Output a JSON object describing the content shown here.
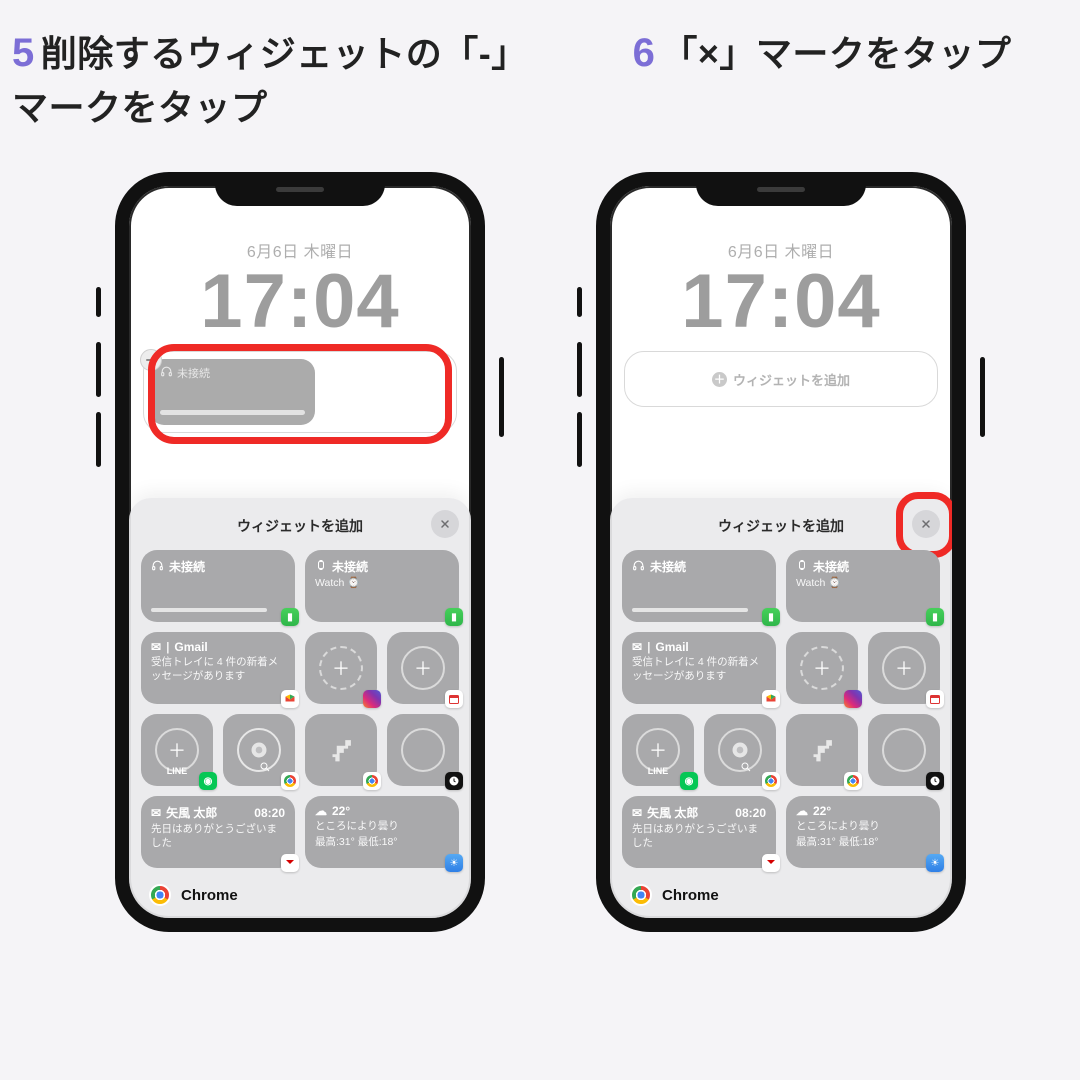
{
  "captions": {
    "step5": {
      "num": "5",
      "text": "削除するウィジェットの「-」マークをタップ"
    },
    "step6": {
      "num": "6",
      "text": "「×」マークをタップ"
    }
  },
  "lockscreen": {
    "date": "6月6日 木曜日",
    "time": "17:04",
    "widget_unconnected": "未接続",
    "add_widget_label": "ウィジェットを追加"
  },
  "sheet": {
    "title": "ウィジェットを追加"
  },
  "widgets": {
    "airpods": {
      "title": "未接続"
    },
    "watch": {
      "title": "未接続",
      "sub": "Watch"
    },
    "gmail": {
      "title": "Gmail",
      "sub": "受信トレイに 4 件の新着メッセージがあります"
    },
    "line": {
      "label": "LINE"
    },
    "mail": {
      "from": "矢風 太郎",
      "time": "08:20",
      "body": "先日はありがとうございました"
    },
    "weather": {
      "temp": "22°",
      "desc": "ところにより曇り",
      "range": "最高:31° 最低:18°"
    }
  },
  "suggestion": {
    "app": "Chrome"
  },
  "icons": {
    "minus": "minus-icon",
    "close": "close-icon",
    "plus": "plus-icon",
    "headphones": "headphones-icon",
    "watch": "watch-icon",
    "gmail": "gmail-icon",
    "chrome": "chrome-icon",
    "line": "line-icon",
    "clock": "clock-icon",
    "weather": "weather-icon",
    "mail": "mail-icon",
    "instagram": "instagram-icon",
    "calendar": "calendar-icon",
    "dino": "dino-icon",
    "battery": "battery-icon"
  },
  "colors": {
    "accent_purple": "#7c6ed6",
    "highlight_red": "#ef2a26"
  }
}
